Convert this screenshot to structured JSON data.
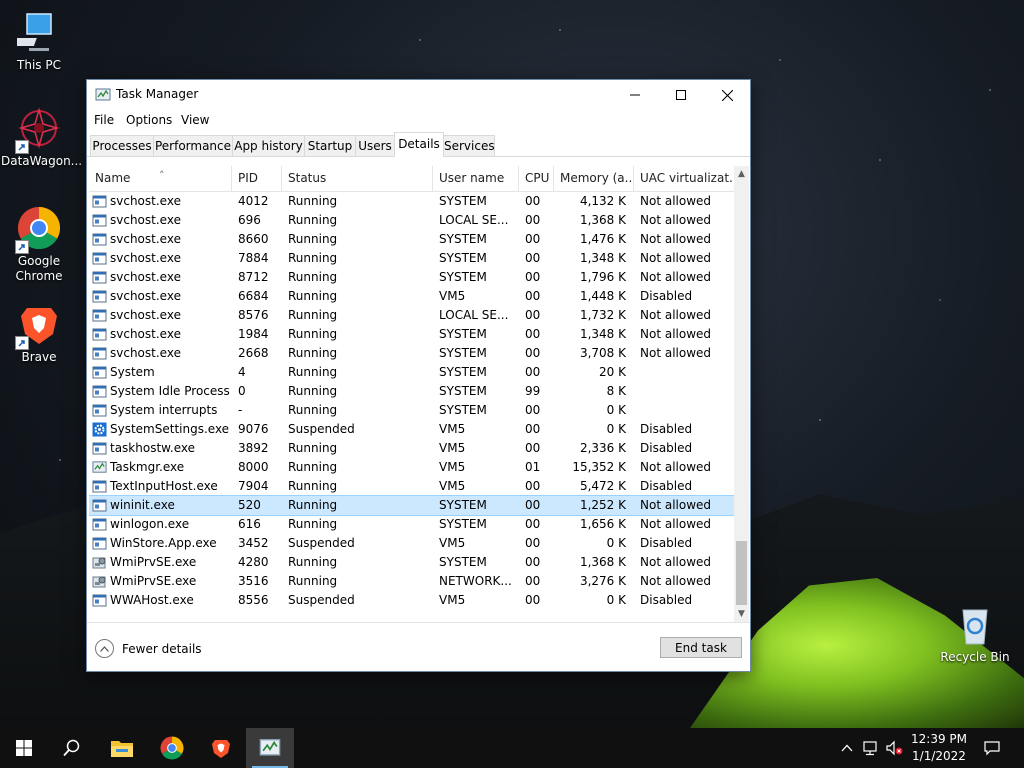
{
  "desktop": {
    "icons": [
      {
        "label": "This PC"
      },
      {
        "label": "DataWagon..."
      },
      {
        "label": "Google Chrome"
      },
      {
        "label": "Brave"
      },
      {
        "label": "Recycle Bin"
      }
    ]
  },
  "window": {
    "title": "Task Manager",
    "menu": [
      "File",
      "Options",
      "View"
    ],
    "tabs": [
      "Processes",
      "Performance",
      "App history",
      "Startup",
      "Users",
      "Details",
      "Services"
    ],
    "active_tab": "Details",
    "columns": [
      "Name",
      "PID",
      "Status",
      "User name",
      "CPU",
      "Memory (a...",
      "UAC virtualizat..."
    ],
    "rows": [
      {
        "name": "svchost.exe",
        "pid": "4012",
        "status": "Running",
        "user": "SYSTEM",
        "cpu": "00",
        "memory": "4,132 K",
        "uac": "Not allowed"
      },
      {
        "name": "svchost.exe",
        "pid": "696",
        "status": "Running",
        "user": "LOCAL SE...",
        "cpu": "00",
        "memory": "1,368 K",
        "uac": "Not allowed"
      },
      {
        "name": "svchost.exe",
        "pid": "8660",
        "status": "Running",
        "user": "SYSTEM",
        "cpu": "00",
        "memory": "1,476 K",
        "uac": "Not allowed"
      },
      {
        "name": "svchost.exe",
        "pid": "7884",
        "status": "Running",
        "user": "SYSTEM",
        "cpu": "00",
        "memory": "1,348 K",
        "uac": "Not allowed"
      },
      {
        "name": "svchost.exe",
        "pid": "8712",
        "status": "Running",
        "user": "SYSTEM",
        "cpu": "00",
        "memory": "1,796 K",
        "uac": "Not allowed"
      },
      {
        "name": "svchost.exe",
        "pid": "6684",
        "status": "Running",
        "user": "VM5",
        "cpu": "00",
        "memory": "1,448 K",
        "uac": "Disabled"
      },
      {
        "name": "svchost.exe",
        "pid": "8576",
        "status": "Running",
        "user": "LOCAL SE...",
        "cpu": "00",
        "memory": "1,732 K",
        "uac": "Not allowed"
      },
      {
        "name": "svchost.exe",
        "pid": "1984",
        "status": "Running",
        "user": "SYSTEM",
        "cpu": "00",
        "memory": "1,348 K",
        "uac": "Not allowed"
      },
      {
        "name": "svchost.exe",
        "pid": "2668",
        "status": "Running",
        "user": "SYSTEM",
        "cpu": "00",
        "memory": "3,708 K",
        "uac": "Not allowed"
      },
      {
        "name": "System",
        "pid": "4",
        "status": "Running",
        "user": "SYSTEM",
        "cpu": "00",
        "memory": "20 K",
        "uac": ""
      },
      {
        "name": "System Idle Process",
        "pid": "0",
        "status": "Running",
        "user": "SYSTEM",
        "cpu": "99",
        "memory": "8 K",
        "uac": ""
      },
      {
        "name": "System interrupts",
        "pid": "-",
        "status": "Running",
        "user": "SYSTEM",
        "cpu": "00",
        "memory": "0 K",
        "uac": ""
      },
      {
        "name": "SystemSettings.exe",
        "pid": "9076",
        "status": "Suspended",
        "user": "VM5",
        "cpu": "00",
        "memory": "0 K",
        "uac": "Disabled",
        "icon": "gear"
      },
      {
        "name": "taskhostw.exe",
        "pid": "3892",
        "status": "Running",
        "user": "VM5",
        "cpu": "00",
        "memory": "2,336 K",
        "uac": "Disabled"
      },
      {
        "name": "Taskmgr.exe",
        "pid": "8000",
        "status": "Running",
        "user": "VM5",
        "cpu": "01",
        "memory": "15,352 K",
        "uac": "Not allowed",
        "icon": "taskmgr"
      },
      {
        "name": "TextInputHost.exe",
        "pid": "7904",
        "status": "Running",
        "user": "VM5",
        "cpu": "00",
        "memory": "5,472 K",
        "uac": "Disabled"
      },
      {
        "name": "wininit.exe",
        "pid": "520",
        "status": "Running",
        "user": "SYSTEM",
        "cpu": "00",
        "memory": "1,252 K",
        "uac": "Not allowed",
        "selected": true
      },
      {
        "name": "winlogon.exe",
        "pid": "616",
        "status": "Running",
        "user": "SYSTEM",
        "cpu": "00",
        "memory": "1,656 K",
        "uac": "Not allowed"
      },
      {
        "name": "WinStore.App.exe",
        "pid": "3452",
        "status": "Suspended",
        "user": "VM5",
        "cpu": "00",
        "memory": "0 K",
        "uac": "Disabled"
      },
      {
        "name": "WmiPrvSE.exe",
        "pid": "4280",
        "status": "Running",
        "user": "SYSTEM",
        "cpu": "00",
        "memory": "1,368 K",
        "uac": "Not allowed",
        "icon": "wmi"
      },
      {
        "name": "WmiPrvSE.exe",
        "pid": "3516",
        "status": "Running",
        "user": "NETWORK...",
        "cpu": "00",
        "memory": "3,276 K",
        "uac": "Not allowed",
        "icon": "wmi"
      },
      {
        "name": "WWAHost.exe",
        "pid": "8556",
        "status": "Suspended",
        "user": "VM5",
        "cpu": "00",
        "memory": "0 K",
        "uac": "Disabled"
      }
    ],
    "fewer_details": "Fewer details",
    "end_task": "End task"
  },
  "taskbar": {
    "time": "12:39 PM",
    "date": "1/1/2022"
  },
  "colors": {
    "selection": "#cce8ff",
    "accent": "#0078d7"
  }
}
